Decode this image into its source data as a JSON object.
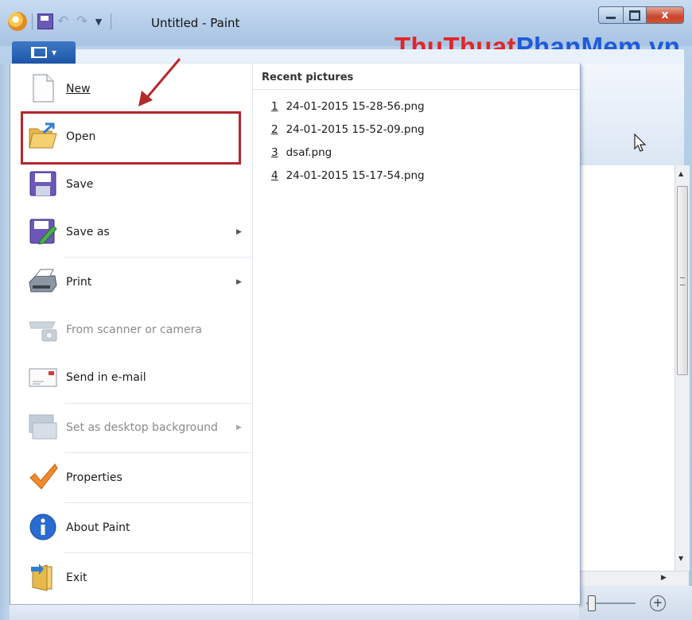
{
  "window": {
    "title": "Untitled - Paint",
    "close_glyph": "x"
  },
  "watermark": {
    "part1": "ThuThuat",
    "part2": "PhanMem",
    "part3": ".vn"
  },
  "colors": {
    "accent_tab": "#1d56a8",
    "highlight_box": "#b5262e",
    "arrow": "#b52a2a",
    "watermark_red": "#e02727",
    "watermark_blue": "#1f5ad9"
  },
  "file_menu": {
    "items": [
      {
        "label": "New",
        "icon": "new-file-icon",
        "enabled": true
      },
      {
        "label": "Open",
        "icon": "open-folder-icon",
        "enabled": true
      },
      {
        "label": "Save",
        "icon": "save-disk-icon",
        "enabled": true
      },
      {
        "label": "Save as",
        "icon": "save-as-icon",
        "enabled": true,
        "submenu": true
      },
      {
        "label": "Print",
        "icon": "printer-icon",
        "enabled": true,
        "submenu": true
      },
      {
        "label": "From scanner or camera",
        "icon": "scanner-camera-icon",
        "enabled": false
      },
      {
        "label": "Send in e-mail",
        "icon": "email-icon",
        "enabled": true
      },
      {
        "label": "Set as desktop background",
        "icon": "desktop-icon",
        "enabled": false,
        "submenu": true
      },
      {
        "label": "Properties",
        "icon": "checkmark-icon",
        "enabled": true
      },
      {
        "label": "About Paint",
        "icon": "info-icon",
        "enabled": true
      },
      {
        "label": "Exit",
        "icon": "exit-icon",
        "enabled": true
      }
    ]
  },
  "recent": {
    "heading": "Recent pictures",
    "items": [
      {
        "num": "1",
        "name": "24-01-2015 15-28-56.png"
      },
      {
        "num": "2",
        "name": "24-01-2015 15-52-09.png"
      },
      {
        "num": "3",
        "name": "dsaf.png"
      },
      {
        "num": "4",
        "name": "24-01-2015 15-17-54.png"
      }
    ]
  },
  "status": {
    "zoom_plus": "+"
  }
}
